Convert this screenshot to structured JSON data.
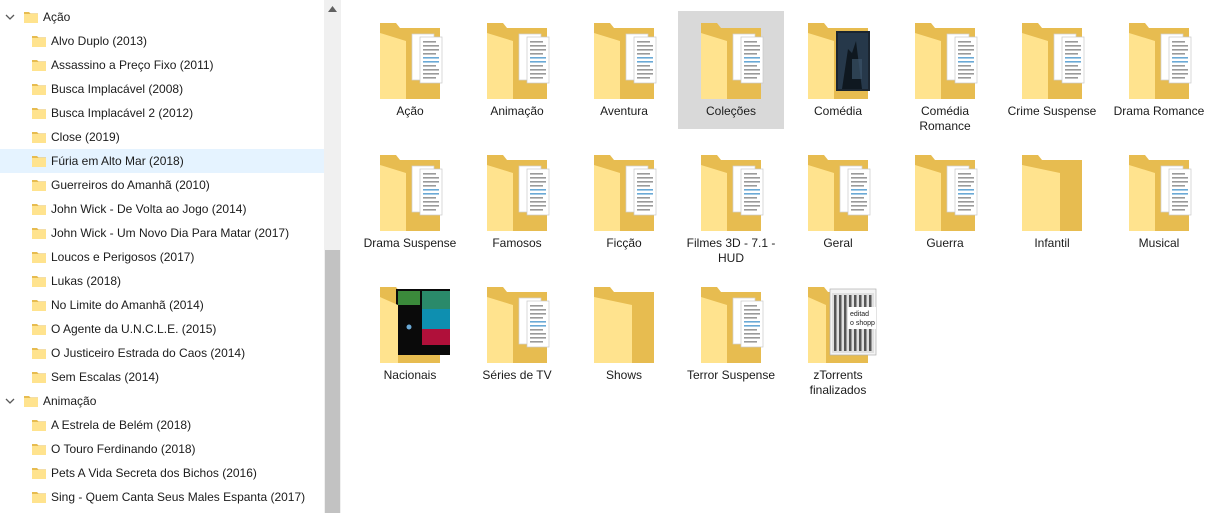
{
  "nav_tree": [
    {
      "label": "Ação",
      "level": 0,
      "expanded": true,
      "selected": false
    },
    {
      "label": "Alvo Duplo (2013)",
      "level": 1,
      "selected": false
    },
    {
      "label": "Assassino a Preço Fixo (2011)",
      "level": 1,
      "selected": false
    },
    {
      "label": "Busca Implacável (2008)",
      "level": 1,
      "selected": false
    },
    {
      "label": "Busca Implacável 2 (2012)",
      "level": 1,
      "selected": false
    },
    {
      "label": "Close (2019)",
      "level": 1,
      "selected": false
    },
    {
      "label": "Fúria em Alto Mar (2018)",
      "level": 1,
      "selected": true
    },
    {
      "label": "Guerreiros do Amanhã (2010)",
      "level": 1,
      "selected": false
    },
    {
      "label": "John Wick - De Volta ao Jogo (2014)",
      "level": 1,
      "selected": false
    },
    {
      "label": "John Wick - Um Novo Dia Para Matar (2017)",
      "level": 1,
      "selected": false
    },
    {
      "label": "Loucos e Perigosos (2017)",
      "level": 1,
      "selected": false
    },
    {
      "label": "Lukas (2018)",
      "level": 1,
      "selected": false
    },
    {
      "label": "No Limite do Amanhã (2014)",
      "level": 1,
      "selected": false
    },
    {
      "label": "O Agente da U.N.C.L.E. (2015)",
      "level": 1,
      "selected": false
    },
    {
      "label": "O Justiceiro Estrada do Caos (2014)",
      "level": 1,
      "selected": false
    },
    {
      "label": "Sem Escalas (2014)",
      "level": 1,
      "selected": false
    },
    {
      "label": "Animação",
      "level": 0,
      "expanded": true,
      "selected": false
    },
    {
      "label": "A Estrela de Belém (2018)",
      "level": 1,
      "selected": false
    },
    {
      "label": "O Touro Ferdinando (2018)",
      "level": 1,
      "selected": false
    },
    {
      "label": "Pets A Vida Secreta dos Bichos (2016)",
      "level": 1,
      "selected": false
    },
    {
      "label": "Sing - Quem Canta Seus Males Espanta (2017)",
      "level": 1,
      "selected": false
    }
  ],
  "folders": [
    {
      "label": "Ação",
      "thumb": "docs",
      "selected": false
    },
    {
      "label": "Animação",
      "thumb": "docs",
      "selected": false
    },
    {
      "label": "Aventura",
      "thumb": "docs",
      "selected": false
    },
    {
      "label": "Coleções",
      "thumb": "docs",
      "selected": true
    },
    {
      "label": "Comédia",
      "thumb": "dark-poster",
      "selected": false
    },
    {
      "label": "Comédia Romance",
      "thumb": "docs",
      "selected": false
    },
    {
      "label": "Crime Suspense",
      "thumb": "docs",
      "selected": false
    },
    {
      "label": "Drama Romance",
      "thumb": "docs",
      "selected": false
    },
    {
      "label": "Drama Suspense",
      "thumb": "docs",
      "selected": false
    },
    {
      "label": "Famosos",
      "thumb": "docs",
      "selected": false
    },
    {
      "label": "Ficção",
      "thumb": "docs",
      "selected": false
    },
    {
      "label": "Filmes 3D - 7.1 - HUD",
      "thumb": "docs",
      "selected": false
    },
    {
      "label": "Geral",
      "thumb": "docs",
      "selected": false
    },
    {
      "label": "Guerra",
      "thumb": "docs",
      "selected": false
    },
    {
      "label": "Infantil",
      "thumb": "empty",
      "selected": false
    },
    {
      "label": "Musical",
      "thumb": "docs",
      "selected": false
    },
    {
      "label": "Nacionais",
      "thumb": "color-poster",
      "selected": false
    },
    {
      "label": "Séries de TV",
      "thumb": "docs",
      "selected": false
    },
    {
      "label": "Shows",
      "thumb": "empty",
      "selected": false
    },
    {
      "label": "Terror Suspense",
      "thumb": "docs",
      "selected": false
    },
    {
      "label": "zTorrents finalizados",
      "thumb": "image-doc",
      "selected": false
    }
  ],
  "thumb_texts": {
    "image_doc_line1": "editad",
    "image_doc_line2": "o shopp"
  },
  "colors": {
    "folder_front": "#ffe38e",
    "folder_back": "#e7bc50",
    "selection_nav": "#e5f3ff",
    "selection_tile": "#d9d9d9"
  }
}
